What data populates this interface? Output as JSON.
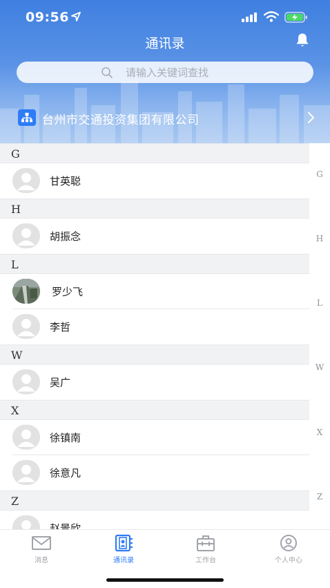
{
  "status_bar": {
    "time": "09:56"
  },
  "header": {
    "title": "通讯录"
  },
  "search": {
    "placeholder": "请输入关键词查找"
  },
  "org": {
    "name": "台州市交通投资集团有限公司"
  },
  "sections": [
    {
      "letter": "G",
      "contacts": [
        {
          "name": "甘英聪",
          "photo": false
        }
      ]
    },
    {
      "letter": "H",
      "contacts": [
        {
          "name": "胡振念",
          "photo": false
        }
      ]
    },
    {
      "letter": "L",
      "contacts": [
        {
          "name": "罗少飞",
          "photo": true
        },
        {
          "name": "李哲",
          "photo": false
        }
      ]
    },
    {
      "letter": "W",
      "contacts": [
        {
          "name": "吴广",
          "photo": false
        }
      ]
    },
    {
      "letter": "X",
      "contacts": [
        {
          "name": "徐镇南",
          "photo": false
        },
        {
          "name": "徐意凡",
          "photo": false
        }
      ]
    },
    {
      "letter": "Z",
      "contacts": [
        {
          "name": "赵景欣",
          "photo": false
        }
      ]
    }
  ],
  "index_letters": [
    "G",
    "H",
    "L",
    "W",
    "X",
    "Z"
  ],
  "tabs": [
    {
      "label": "消息",
      "icon": "mail-icon",
      "active": false
    },
    {
      "label": "通讯录",
      "icon": "contacts-icon",
      "active": true
    },
    {
      "label": "工作台",
      "icon": "briefcase-icon",
      "active": false
    },
    {
      "label": "个人中心",
      "icon": "user-circle-icon",
      "active": false
    }
  ],
  "colors": {
    "accent": "#2e7cf6",
    "header_top": "#3f7fe0",
    "inactive_tab": "#a0a3a8"
  }
}
